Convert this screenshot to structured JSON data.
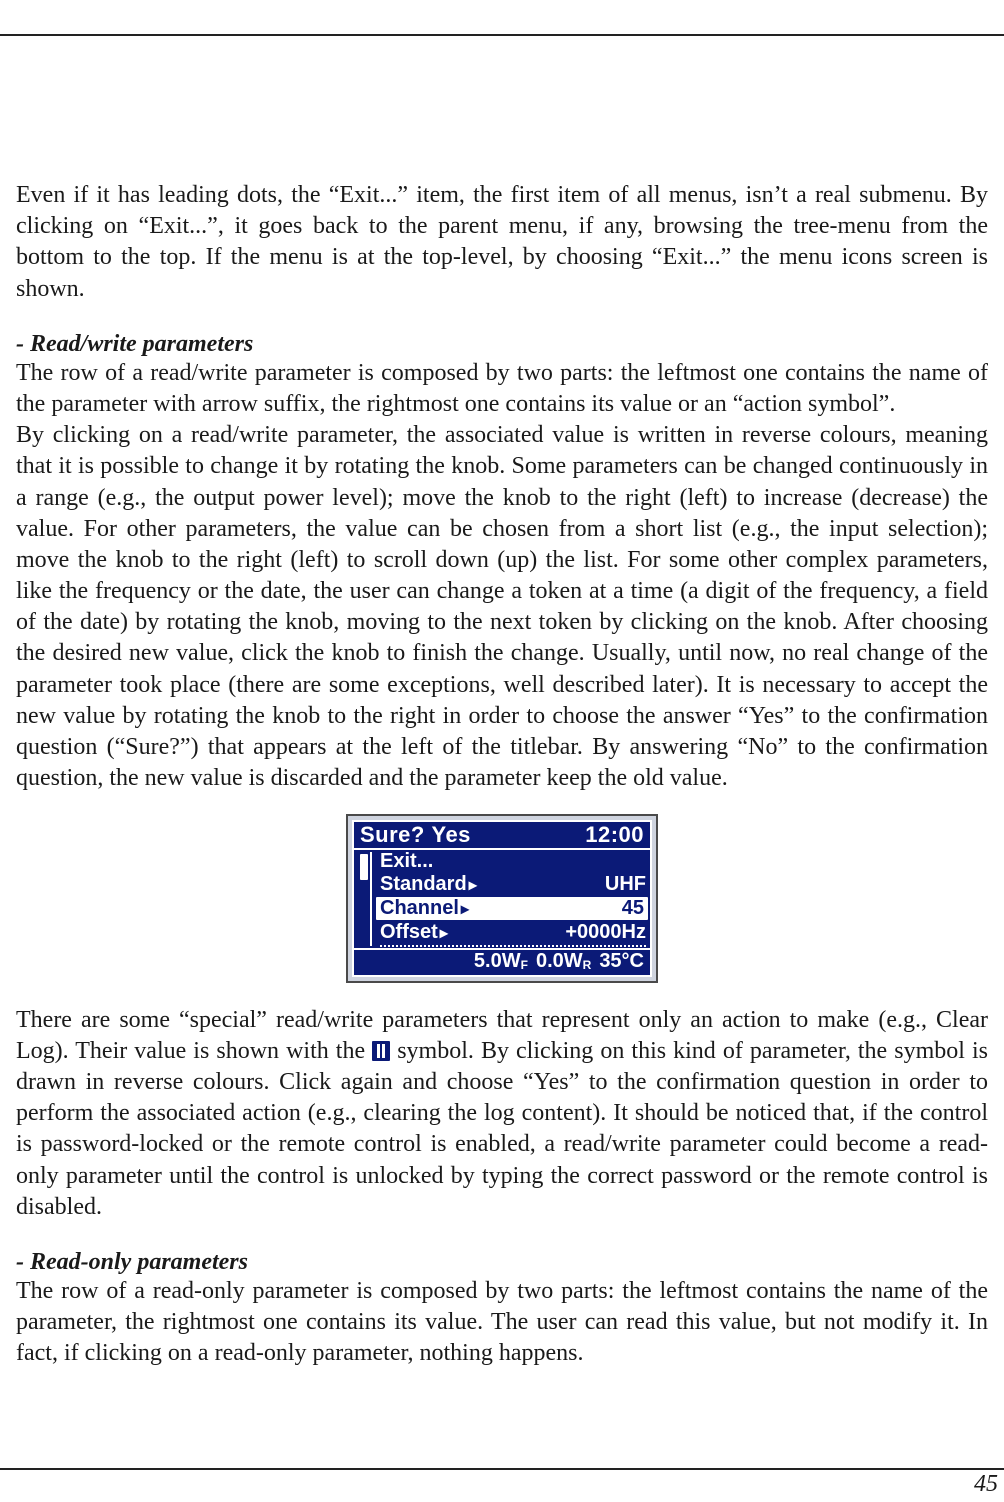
{
  "page_number": "45",
  "intro_para": "Even if it has leading dots, the “Exit...” item, the first item of all menus, isn’t a real submenu. By clicking on “Exit...”, it goes back to the parent menu, if any, browsing the tree-menu from the bottom to the top. If the menu is at the top-level, by choosing “Exit...” the menu icons screen is shown.",
  "sections": {
    "rw": {
      "heading": "- Read/write parameters",
      "para": "The row of a read/write parameter is composed by two parts: the leftmost one contains the name of the parameter with arrow suffix, the rightmost one contains its value or an “action symbol”.\nBy clicking on a read/write parameter, the associated value is written in reverse colours, meaning that it is possible to change it by rotating the knob. Some parameters can be changed continuously in a range (e.g., the output power level); move the knob to the right (left) to increase (decrease) the value. For other parameters, the value can be chosen from a short list (e.g., the input selection); move the knob to the right (left) to scroll down (up) the list. For some other complex parameters, like the frequency or the date, the user can change a token at a time (a digit of the frequency, a field of the date) by rotating the knob, moving to the next token by clicking on the knob. After choosing the desired new value, click the knob to finish the change. Usually, until now, no real change of the parameter took place (there are some exceptions, well described later). It is necessary to accept the new value by rotating the knob to the right in order to choose the answer “Yes” to the confirmation question (“Sure?”) that appears at the left of the titlebar. By answering “No” to the confirmation question, the new value is discarded and the parameter keep the old value.",
      "after_para_a": "There are some “special” read/write parameters that represent only an action to make (e.g., Clear Log). Their value is shown with the ",
      "after_para_b": " symbol. By clicking on this kind of parameter, the  symbol is drawn in reverse colours. Click again and choose “Yes” to the confirmation question in order to perform the associated action (e.g., clearing the log content). It should be noticed that, if the control is password-locked or the remote control is enabled, a read/write parameter could become a read-only parameter until the control is unlocked by typing the correct password or the remote control is disabled."
    },
    "ro": {
      "heading": "- Read-only parameters",
      "para": "The row of a read-only parameter is composed by two parts: the leftmost contains the name of the parameter, the rightmost one contains its value. The user can read this value, but not modify it. In fact, if clicking on a read-only parameter, nothing happens."
    }
  },
  "lcd": {
    "title_left": "Sure?",
    "title_answer": "Yes",
    "title_right": "12:00",
    "rows": [
      {
        "label": "Exit...",
        "value": "",
        "arrow": false,
        "selected": false
      },
      {
        "label": "Standard",
        "value": "UHF",
        "arrow": true,
        "selected": false
      },
      {
        "label": "Channel",
        "value": "45",
        "arrow": true,
        "selected": true
      },
      {
        "label": "Offset",
        "value": "+0000Hz",
        "arrow": true,
        "selected": false
      }
    ],
    "status": {
      "fwd": "5.0W",
      "fwd_sub": "F",
      "ref": "0.0W",
      "ref_sub": "R",
      "temp": "35°C"
    }
  }
}
